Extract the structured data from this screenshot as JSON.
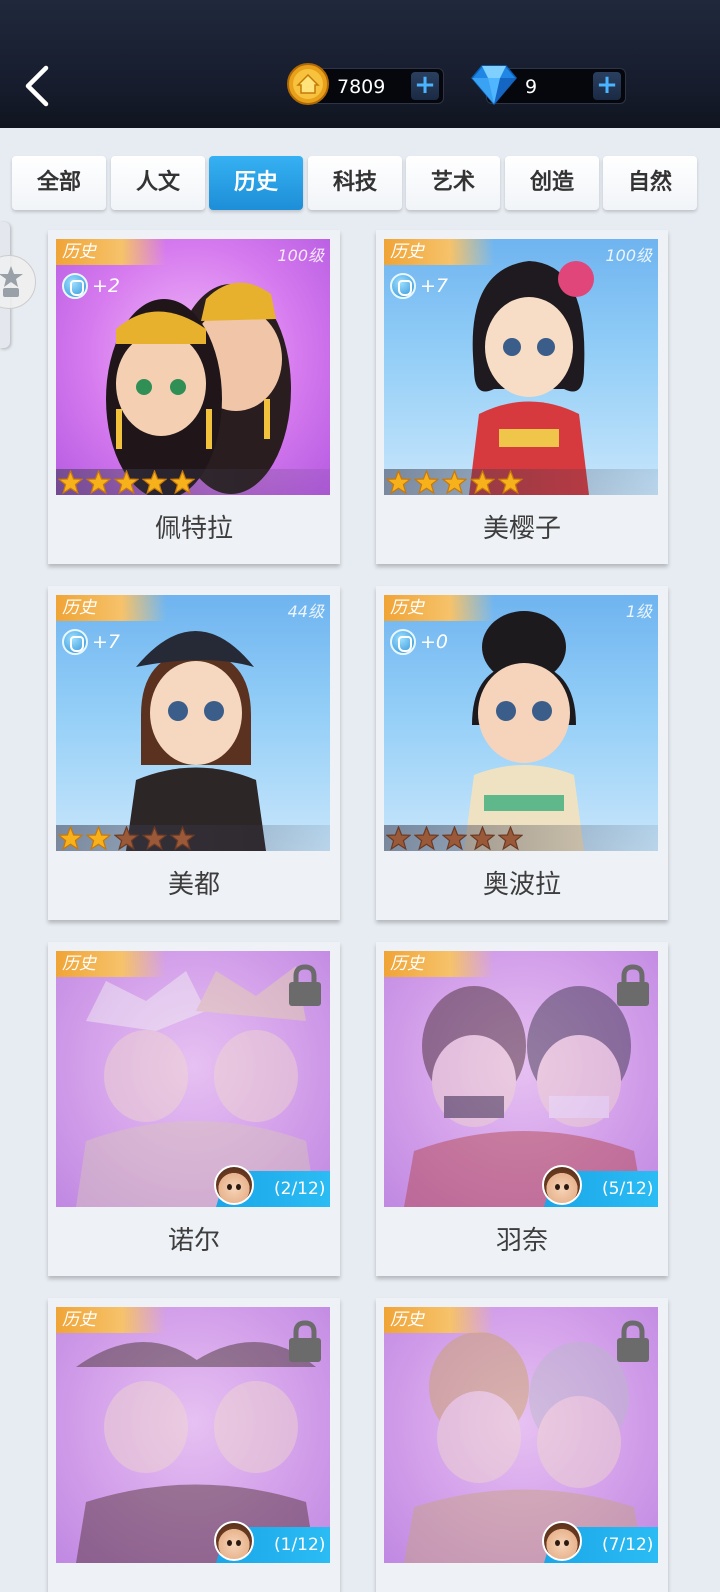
{
  "header": {
    "coins": "7809",
    "gems": "9",
    "plus": "+"
  },
  "tabs": [
    {
      "label": "全部",
      "active": false
    },
    {
      "label": "人文",
      "active": false
    },
    {
      "label": "历史",
      "active": true
    },
    {
      "label": "科技",
      "active": false
    },
    {
      "label": "艺术",
      "active": false
    },
    {
      "label": "创造",
      "active": false
    },
    {
      "label": "自然",
      "active": false
    }
  ],
  "cards": [
    {
      "name": "佩特拉",
      "category": "历史",
      "level": "100级",
      "skill": "+2",
      "stars": 5,
      "max_stars": 5,
      "locked": false,
      "bg": "purple"
    },
    {
      "name": "美樱子",
      "category": "历史",
      "level": "100级",
      "skill": "+7",
      "stars": 5,
      "max_stars": 5,
      "locked": false,
      "bg": "blue"
    },
    {
      "name": "美都",
      "category": "历史",
      "level": "44级",
      "skill": "+7",
      "stars": 2,
      "max_stars": 5,
      "locked": false,
      "bg": "blue"
    },
    {
      "name": "奥波拉",
      "category": "历史",
      "level": "1级",
      "skill": "+0",
      "stars": 0,
      "max_stars": 5,
      "locked": false,
      "bg": "blue"
    },
    {
      "name": "诺尔",
      "category": "历史",
      "progress": "(2/12)",
      "locked": true,
      "bg": "locked"
    },
    {
      "name": "羽奈",
      "category": "历史",
      "progress": "(5/12)",
      "locked": true,
      "bg": "locked"
    },
    {
      "name": "",
      "category": "历史",
      "progress": "(1/12)",
      "locked": true,
      "bg": "locked"
    },
    {
      "name": "",
      "category": "历史",
      "progress": "(7/12)",
      "locked": true,
      "bg": "locked"
    }
  ],
  "colors": {
    "tab_active": "#1d8ed8",
    "category_tag": "#f0a436",
    "progress_tag": "#1aa6e8",
    "star_filled": "#f7b21b",
    "star_empty": "#9a5a3a"
  },
  "icons": {
    "back": "chevron-left-icon",
    "coin": "coin-icon",
    "gem": "diamond-icon",
    "lock": "lock-icon",
    "skill": "skill-badge-icon",
    "star": "star-icon"
  }
}
